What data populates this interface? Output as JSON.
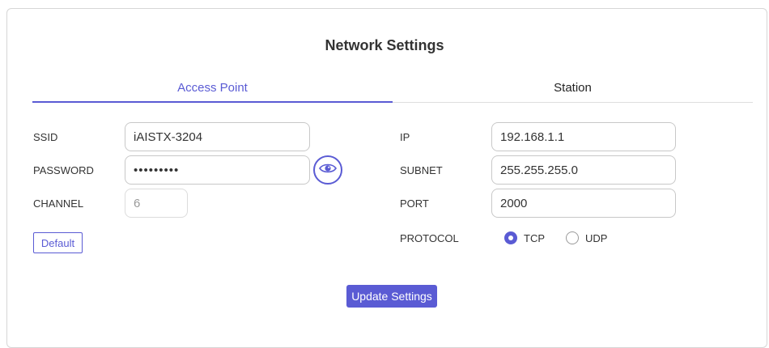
{
  "title": "Network Settings",
  "tabs": [
    {
      "label": "Access Point",
      "active": true
    },
    {
      "label": "Station",
      "active": false
    }
  ],
  "access_point": {
    "ssid_label": "SSID",
    "ssid_value": "iAISTX-3204",
    "password_label": "PASSWORD",
    "password_value": "•••••••••",
    "channel_label": "CHANNEL",
    "channel_value": "6",
    "default_button": "Default",
    "show_password_icon": "eye-icon"
  },
  "network": {
    "ip_label": "IP",
    "ip_value": "192.168.1.1",
    "subnet_label": "SUBNET",
    "subnet_value": "255.255.255.0",
    "port_label": "PORT",
    "port_value": "2000",
    "protocol_label": "PROTOCOL",
    "protocol_options": [
      {
        "label": "TCP",
        "selected": true
      },
      {
        "label": "UDP",
        "selected": false
      }
    ]
  },
  "update_button": "Update Settings",
  "colors": {
    "accent": "#5a5bd4",
    "border": "#c8c8c8",
    "text": "#333333"
  }
}
